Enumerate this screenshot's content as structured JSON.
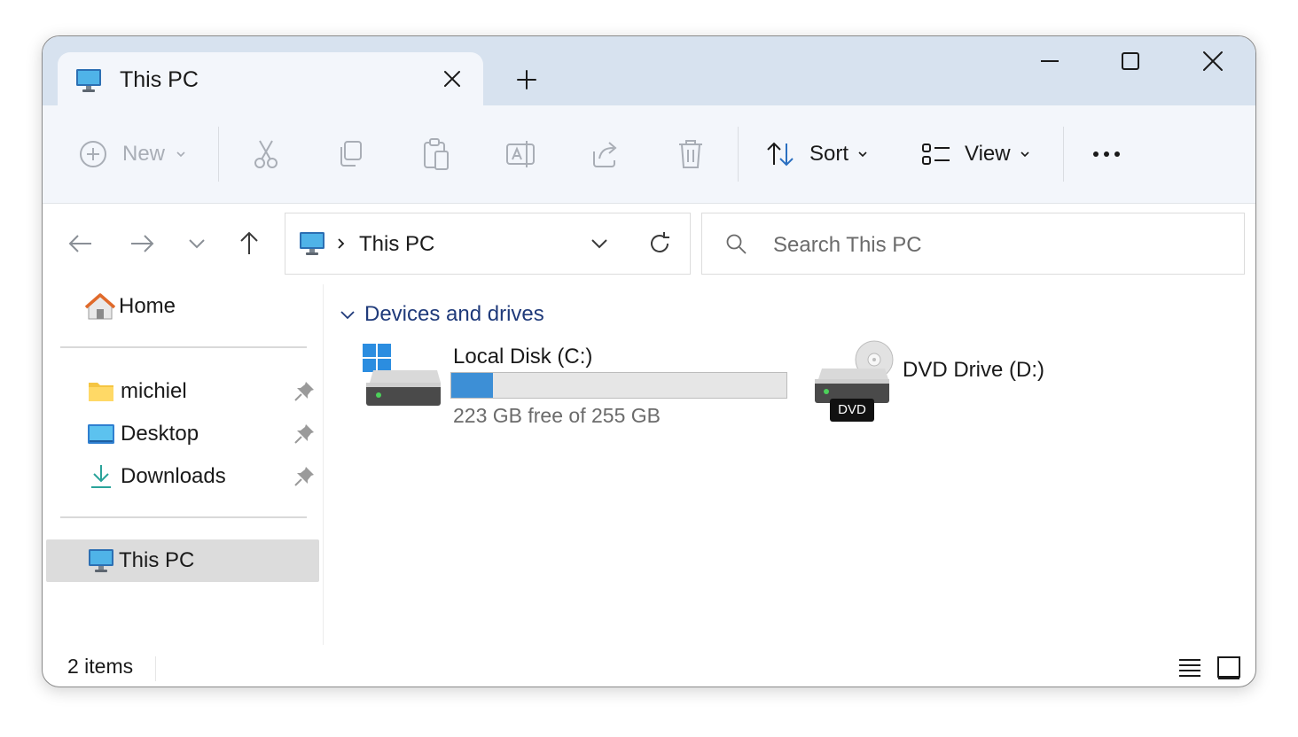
{
  "tab": {
    "title": "This PC"
  },
  "toolbar": {
    "new_label": "New",
    "sort_label": "Sort",
    "view_label": "View"
  },
  "address": {
    "location": "This PC"
  },
  "search": {
    "placeholder": "Search This PC"
  },
  "sidebar": {
    "home": "Home",
    "pinned": [
      {
        "label": "michiel",
        "icon": "folder-icon"
      },
      {
        "label": "Desktop",
        "icon": "desktop-folder-icon"
      },
      {
        "label": "Downloads",
        "icon": "download-icon"
      }
    ],
    "this_pc": "This PC"
  },
  "content": {
    "group_label": "Devices and drives",
    "drives": [
      {
        "name": "Local Disk (C:)",
        "free_text": "223 GB free of 255 GB",
        "used_fraction": 0.125
      },
      {
        "name": "DVD Drive (D:)",
        "badge": "DVD"
      }
    ]
  },
  "status": {
    "items": "2 items"
  },
  "colors": {
    "titlebar": "#d7e2ef",
    "accent": "#3d8fd6",
    "group_heading": "#1f3a7a"
  }
}
